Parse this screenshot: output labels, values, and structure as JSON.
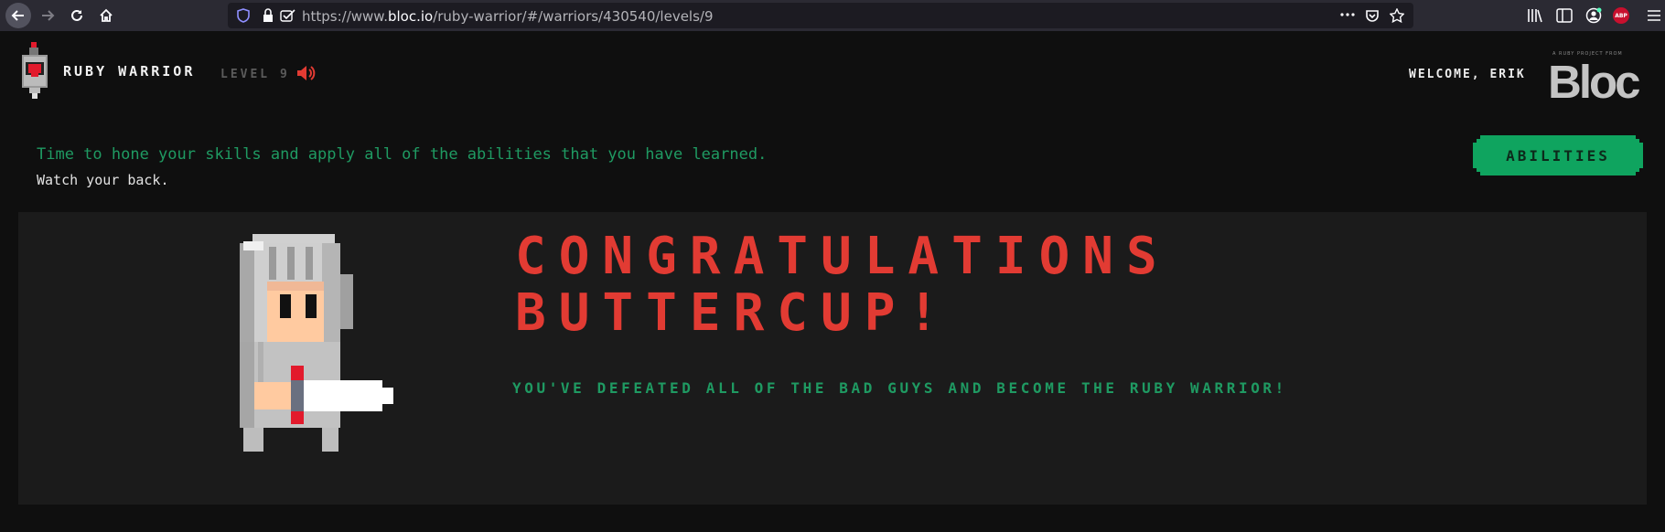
{
  "browser": {
    "url_prefix": "https://www.",
    "url_host": "bloc.io",
    "url_path": "/ruby-warrior/#/warriors/430540/levels/9",
    "ext_badge": "ABP"
  },
  "header": {
    "brand": "RUBY WARRIOR",
    "level": "LEVEL 9",
    "welcome": "WELCOME, ERIK",
    "bloc_tagline": "A RUBY PROJECT FROM",
    "bloc_logo": "Bloc"
  },
  "intro": {
    "line1": "Time to hone your skills and apply all of the abilities that you have learned.",
    "line2": "Watch your back.",
    "abilities_button": "ABILITIES"
  },
  "result": {
    "title_line1": "CONGRATULATIONS",
    "title_line2": "BUTTERCUP!",
    "message": "YOU'VE DEFEATED ALL OF THE BAD GUYS AND BECOME THE RUBY WARRIOR!"
  },
  "colors": {
    "accent_green": "#0fa45f",
    "title_red": "#e23b33",
    "page_bg": "#0f0f0f",
    "panel_bg": "#1b1b1b"
  }
}
